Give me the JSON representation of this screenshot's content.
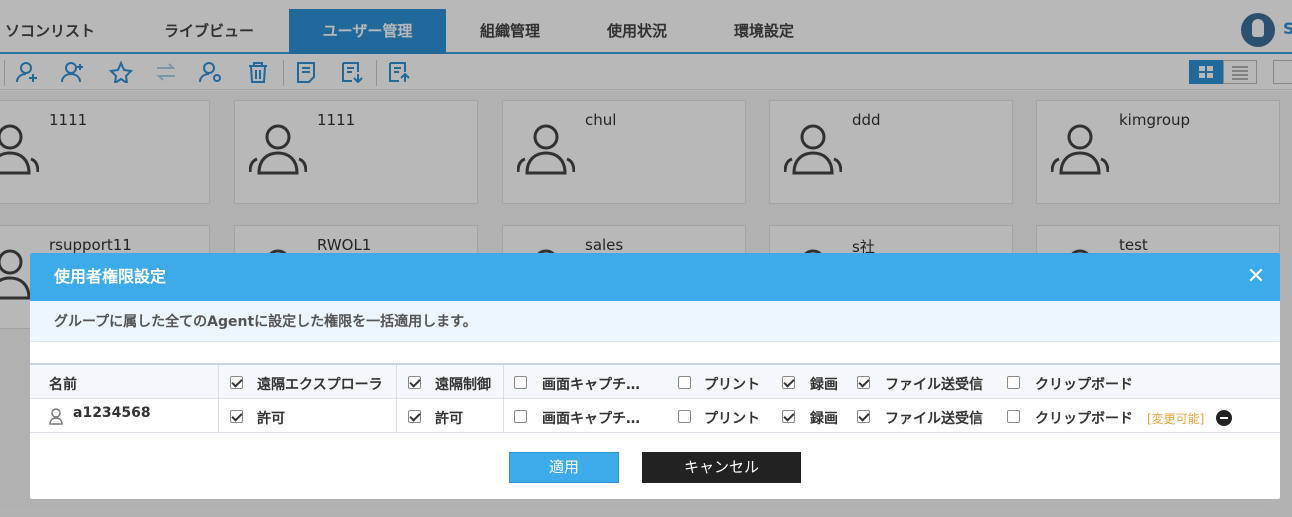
{
  "nav": {
    "tabs": [
      {
        "label": "ソコンリスト",
        "active": false
      },
      {
        "label": "ライブビュー",
        "active": false
      },
      {
        "label": "ユーザー管理",
        "active": true
      },
      {
        "label": "組織管理",
        "active": false
      },
      {
        "label": "使用状況",
        "active": false
      },
      {
        "label": "環境設定",
        "active": false
      }
    ],
    "user_initial": "S"
  },
  "toolbar": {
    "icons": [
      "add-group-icon",
      "add-user-icon",
      "favorite-add-icon",
      "transfer-icon",
      "user-settings-icon",
      "delete-icon",
      "memo-icon",
      "export-icon",
      "import-icon"
    ],
    "view_modes": [
      "grid-view",
      "list-view"
    ]
  },
  "groups": [
    {
      "name": "1111"
    },
    {
      "name": "1111"
    },
    {
      "name": "chul"
    },
    {
      "name": "ddd"
    },
    {
      "name": "kimgroup"
    },
    {
      "name": "rsupport11"
    },
    {
      "name": "RWOL1"
    },
    {
      "name": "sales"
    },
    {
      "name": "s社"
    },
    {
      "name": "test"
    }
  ],
  "modal": {
    "title": "使用者権限設定",
    "description": "グループに属した全てのAgentに設定した権限を一括適用します。",
    "header": {
      "name_label": "名前",
      "perms": [
        {
          "label": "遠隔エクスプローラ",
          "checked": true
        },
        {
          "label": "遠隔制御",
          "checked": true
        },
        {
          "label": "画面キャプチ…",
          "checked": false
        },
        {
          "label": "プリント",
          "checked": false
        },
        {
          "label": "録画",
          "checked": true
        },
        {
          "label": "ファイル送受信",
          "checked": true
        },
        {
          "label": "クリップボード",
          "checked": false
        }
      ]
    },
    "row": {
      "user": "a1234568",
      "perms": [
        {
          "label": "許可",
          "checked": true
        },
        {
          "label": "許可",
          "checked": true
        },
        {
          "label": "画面キャプチ…",
          "checked": false
        },
        {
          "label": "プリント",
          "checked": false
        },
        {
          "label": "録画",
          "checked": true
        },
        {
          "label": "ファイル送受信",
          "checked": true
        },
        {
          "label": "クリップボード",
          "checked": false
        }
      ],
      "changeable_label": "[変更可能]"
    },
    "apply_label": "適用",
    "cancel_label": "キャンセル"
  }
}
